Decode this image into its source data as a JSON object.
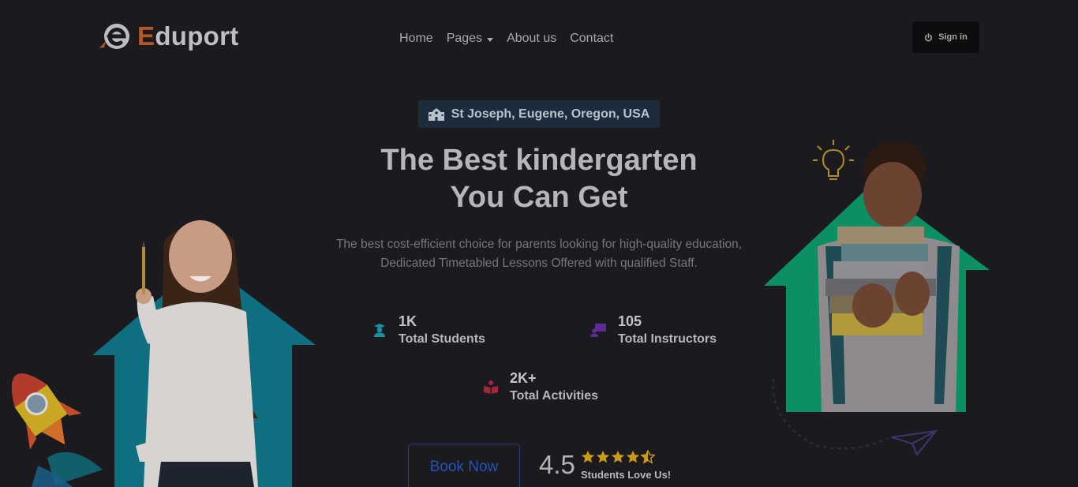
{
  "brand": {
    "name_accent": "E",
    "name_rest": "duport",
    "accent_color": "#b4582a"
  },
  "nav": {
    "items": [
      {
        "label": "Home"
      },
      {
        "label": "Pages",
        "has_dropdown": true
      },
      {
        "label": "About us"
      },
      {
        "label": "Contact"
      }
    ],
    "signin_label": "Sign in",
    "signin_icon": "power-icon"
  },
  "hero": {
    "location": "St Joseph, Eugene, Oregon, USA",
    "location_icon": "school-building-icon",
    "title_line1": "The Best kindergarten",
    "title_line2": "You Can Get",
    "subtitle_line1": "The best cost-efficient choice for parents looking for high-quality education,",
    "subtitle_line2": "Dedicated Timetabled Lessons Offered with qualified Staff."
  },
  "stats": [
    {
      "value": "1K",
      "label": "Total Students",
      "icon": "student-icon",
      "color": "#1a8ea2"
    },
    {
      "value": "105",
      "label": "Total Instructors",
      "icon": "instructor-icon",
      "color": "#5e2c9a"
    },
    {
      "value": "2K+",
      "label": "Total Activities",
      "icon": "book-icon",
      "color": "#a3263a"
    }
  ],
  "cta": {
    "book_label": "Book Now"
  },
  "rating": {
    "value": "4.5",
    "stars": 4.5,
    "label": "Students Love Us!",
    "star_color": "#c89a15"
  },
  "colors": {
    "bg": "#1b1b1f",
    "teal_shape": "#0f6f80",
    "green_shape": "#0c8f63"
  }
}
